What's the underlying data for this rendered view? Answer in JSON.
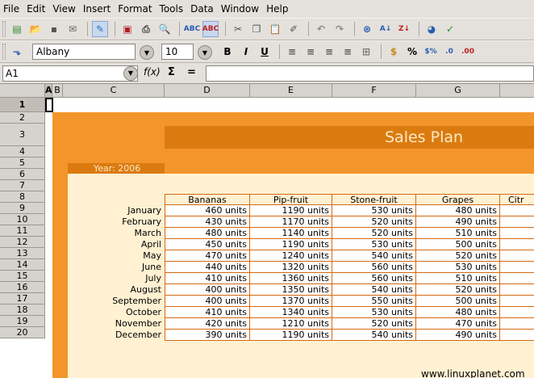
{
  "menu": [
    "File",
    "Edit",
    "View",
    "Insert",
    "Format",
    "Tools",
    "Data",
    "Window",
    "Help"
  ],
  "toolbar": {
    "font_name": "Albany",
    "font_size": "10"
  },
  "formula_bar": {
    "cell_ref": "A1",
    "fx_label": "f(x)",
    "sum_label": "Σ",
    "equals_label": "=",
    "content": ""
  },
  "columns": [
    "A",
    "B",
    "C",
    "D",
    "E",
    "F",
    "G",
    "Citr"
  ],
  "rows": [
    "1",
    "2",
    "3",
    "4",
    "5",
    "6",
    "7",
    "8",
    "9",
    "10",
    "11",
    "12",
    "13",
    "14",
    "15",
    "16",
    "17",
    "18",
    "19",
    "20"
  ],
  "sheet": {
    "title": "Sales Plan",
    "year_label": "Year: 2006",
    "headers": [
      "Bananas",
      "Pip-fruit",
      "Stone-fruit",
      "Grapes",
      "Citr"
    ],
    "months": [
      "January",
      "February",
      "March",
      "April",
      "May",
      "June",
      "July",
      "August",
      "September",
      "October",
      "November",
      "December"
    ],
    "values": [
      [
        "460 units",
        "1190 units",
        "530 units",
        "480 units"
      ],
      [
        "430 units",
        "1170 units",
        "520 units",
        "490 units"
      ],
      [
        "480 units",
        "1140 units",
        "520 units",
        "510 units"
      ],
      [
        "450 units",
        "1190 units",
        "530 units",
        "500 units"
      ],
      [
        "470 units",
        "1240 units",
        "540 units",
        "520 units"
      ],
      [
        "440 units",
        "1320 units",
        "560 units",
        "530 units"
      ],
      [
        "410 units",
        "1360 units",
        "560 units",
        "510 units"
      ],
      [
        "400 units",
        "1350 units",
        "540 units",
        "520 units"
      ],
      [
        "400 units",
        "1370 units",
        "550 units",
        "500 units"
      ],
      [
        "410 units",
        "1340 units",
        "530 units",
        "480 units"
      ],
      [
        "420 units",
        "1210 units",
        "520 units",
        "470 units"
      ],
      [
        "390 units",
        "1190 units",
        "540 units",
        "490 units"
      ]
    ],
    "watermark": "www.linuxplanet.com"
  },
  "colors": {
    "orange": "#f3952a",
    "dark_orange": "#db7b0f",
    "cream": "#fff1d2"
  }
}
